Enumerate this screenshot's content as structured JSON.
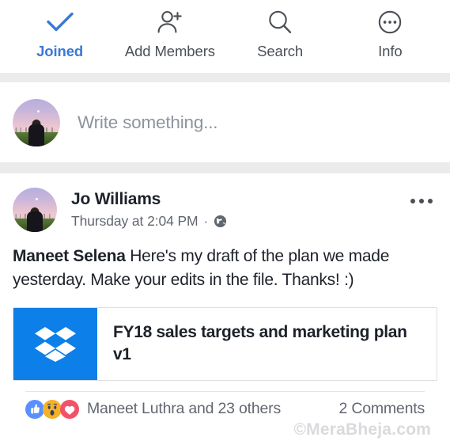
{
  "actionbar": {
    "items": [
      {
        "label": "Joined",
        "icon": "check-icon",
        "active": true
      },
      {
        "label": "Add Members",
        "icon": "add-person-icon",
        "active": false
      },
      {
        "label": "Search",
        "icon": "search-icon",
        "active": false
      },
      {
        "label": "Info",
        "icon": "info-dots-icon",
        "active": false
      }
    ]
  },
  "composer": {
    "placeholder": "Write something...",
    "avatar_alt": "user-avatar"
  },
  "post": {
    "author": "Jo Williams",
    "timestamp": "Thursday at 2:04 PM",
    "separator": "·",
    "privacy_icon": "globe-icon",
    "more_icon": "ellipsis-icon",
    "body_tag": "Maneet Selena",
    "body_text": " Here's my draft of the plan we made yesterday. Make your edits in the file. Thanks! :)",
    "attachment": {
      "provider_icon": "dropbox-icon",
      "title": "FY18 sales targets and marketing plan v1",
      "brand_color": "#0d7fe8"
    },
    "footer": {
      "reactions": [
        "like-icon",
        "wow-icon",
        "love-icon"
      ],
      "reaction_text": "Maneet Luthra and 23 others",
      "comments_text": "2 Comments"
    }
  },
  "watermark": "©MeraBheja.com",
  "colors": {
    "accent_blue": "#3b78d8",
    "dropbox_blue": "#0d7fe8",
    "text_primary": "#1d2129",
    "text_secondary": "#616770",
    "band_gray": "#ebebeb"
  }
}
